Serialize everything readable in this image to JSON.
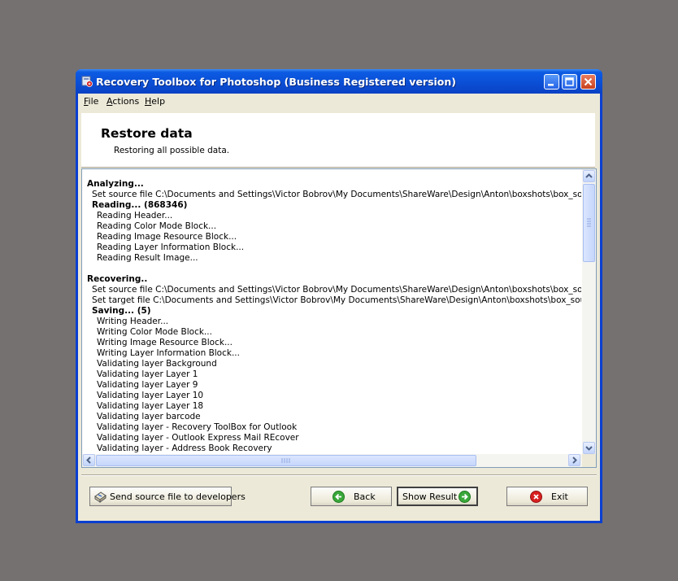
{
  "window": {
    "title": "Recovery Toolbox for Photoshop (Business Registered version)",
    "icons": {
      "app": "app-icon",
      "minimize": "minimize-icon",
      "maximize": "maximize-icon",
      "close": "close-icon"
    }
  },
  "menu": {
    "items": [
      {
        "hot": "F",
        "rest": "ile"
      },
      {
        "hot": "A",
        "rest": "ctions"
      },
      {
        "hot": "H",
        "rest": "elp"
      }
    ]
  },
  "header": {
    "title": "Restore data",
    "subtitle": "Restoring all possible data."
  },
  "log": {
    "lines": [
      {
        "text": "Analyzing...",
        "bold": true,
        "indent": 0
      },
      {
        "text": "Set source file C:\\Documents and Settings\\Victor Bobrov\\My Documents\\ShareWare\\Design\\Anton\\boxshots\\box_source_se",
        "bold": false,
        "indent": 1
      },
      {
        "text": "Reading... (868346)",
        "bold": true,
        "indent": 1
      },
      {
        "text": "Reading Header...",
        "bold": false,
        "indent": 2
      },
      {
        "text": "Reading Color Mode Block...",
        "bold": false,
        "indent": 2
      },
      {
        "text": "Reading Image Resource Block...",
        "bold": false,
        "indent": 2
      },
      {
        "text": "Reading Layer Information Block...",
        "bold": false,
        "indent": 2
      },
      {
        "text": "Reading Result Image...",
        "bold": false,
        "indent": 2
      },
      {
        "text": "",
        "bold": false,
        "indent": 0
      },
      {
        "text": "Recovering..",
        "bold": true,
        "indent": 0
      },
      {
        "text": "Set source file C:\\Documents and Settings\\Victor Bobrov\\My Documents\\ShareWare\\Design\\Anton\\boxshots\\box_source_se",
        "bold": false,
        "indent": 1
      },
      {
        "text": "Set target file C:\\Documents and Settings\\Victor Bobrov\\My Documents\\ShareWare\\Design\\Anton\\boxshots\\box_source_se",
        "bold": false,
        "indent": 1
      },
      {
        "text": "Saving... (5)",
        "bold": true,
        "indent": 1
      },
      {
        "text": "Writing Header...",
        "bold": false,
        "indent": 2
      },
      {
        "text": "Writing Color Mode Block...",
        "bold": false,
        "indent": 2
      },
      {
        "text": "Writing Image Resource Block...",
        "bold": false,
        "indent": 2
      },
      {
        "text": "Writing Layer Information Block...",
        "bold": false,
        "indent": 2
      },
      {
        "text": "Validating layer Background",
        "bold": false,
        "indent": 2
      },
      {
        "text": "Validating layer Layer 1",
        "bold": false,
        "indent": 2
      },
      {
        "text": "Validating layer Layer 9",
        "bold": false,
        "indent": 2
      },
      {
        "text": "Validating layer Layer 10",
        "bold": false,
        "indent": 2
      },
      {
        "text": "Validating layer Layer 18",
        "bold": false,
        "indent": 2
      },
      {
        "text": "Validating layer barcode",
        "bold": false,
        "indent": 2
      },
      {
        "text": "Validating layer - Recovery ToolBox for Outlook",
        "bold": false,
        "indent": 2
      },
      {
        "text": "Validating layer - Outlook Express Mail REcover",
        "bold": false,
        "indent": 2
      },
      {
        "text": "Validating layer - Address Book Recovery",
        "bold": false,
        "indent": 2
      }
    ]
  },
  "buttons": {
    "send": {
      "label": "Send source file to developers",
      "icon": "send-file-icon"
    },
    "back": {
      "label": "Back",
      "icon": "back-arrow-icon"
    },
    "show_result": {
      "label": "Show Result",
      "icon": "forward-arrow-icon"
    },
    "exit": {
      "label": "Exit",
      "icon": "exit-icon"
    }
  },
  "colors": {
    "titlebar": "#0a4fd6",
    "desktop": "#757171",
    "dialog_face": "#ece9d8",
    "arrow_green": "#3aa83a",
    "exit_red": "#d92020"
  }
}
